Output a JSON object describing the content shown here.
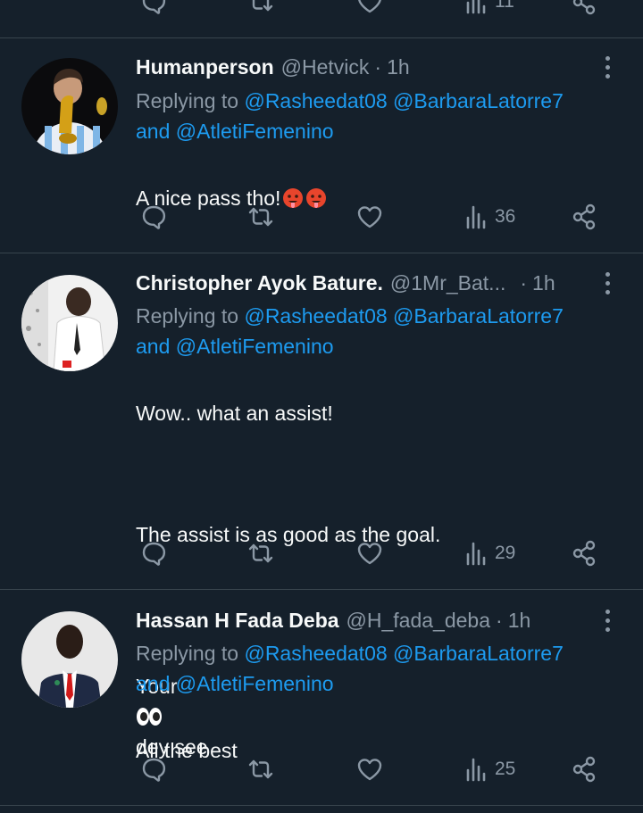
{
  "previous": {
    "views": "11"
  },
  "tweets": [
    {
      "name": "Humanperson",
      "handle": "@Hetvick",
      "separator": "·",
      "time": "1h",
      "replying_prefix": "Replying to",
      "mention1": "@Rasheedat08",
      "mention2": "@BarbaraLatorre7",
      "and_text": "and",
      "mention3": "@AtletiFemenino",
      "text": "A nice pass tho!",
      "emoji": "hot-face-emoji",
      "views": "36"
    },
    {
      "name": "Christopher Ayok Bature.",
      "handle": "@1Mr_Bat...",
      "separator": "·",
      "time": "1h",
      "replying_prefix": "Replying to",
      "mention1": "@Rasheedat08",
      "mention2": "@BarbaraLatorre7",
      "and_text": "and",
      "mention3": "@AtletiFemenino",
      "line1": "Wow.. what an assist!",
      "line2": "The assist is as good as the goal.",
      "line3a": "Your",
      "line3b": "dey see",
      "emoji": "eyes-emoji",
      "views": "29"
    },
    {
      "name": "Hassan H Fada Deba",
      "handle": "@H_fada_deba",
      "separator": "·",
      "time": "1h",
      "replying_prefix": "Replying to",
      "mention1": "@Rasheedat08",
      "mention2": "@BarbaraLatorre7",
      "and_text": "and",
      "mention3": "@AtletiFemenino",
      "text": "All the best",
      "views": "25"
    }
  ],
  "icons": [
    "reply-icon",
    "retweet-icon",
    "like-icon",
    "views-icon",
    "share-icon",
    "more-icon"
  ],
  "colors": {
    "background": "#15202b",
    "accent": "#1d9bf0",
    "muted": "#8b98a5",
    "text": "#f7f9f9",
    "divider": "#38444d"
  }
}
